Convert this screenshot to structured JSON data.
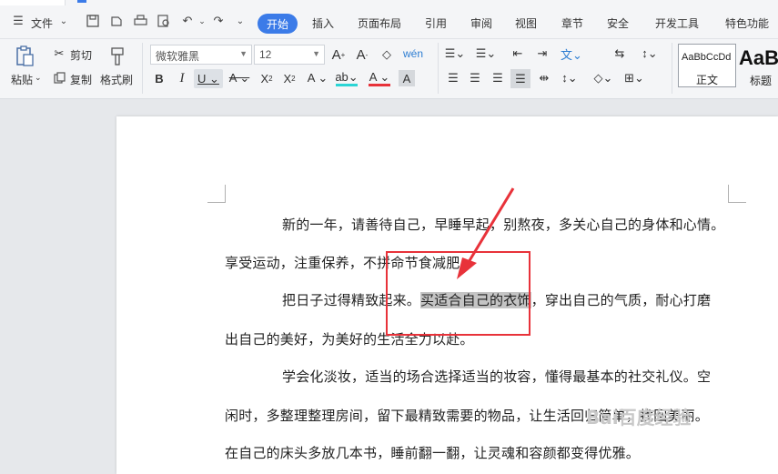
{
  "menubar": {
    "file_label": "文件",
    "tabs": [
      "开始",
      "插入",
      "页面布局",
      "引用",
      "审阅",
      "视图",
      "章节",
      "安全",
      "开发工具",
      "特色功能"
    ]
  },
  "ribbon": {
    "paste_label": "粘贴",
    "cut_label": "剪切",
    "copy_label": "复制",
    "format_painter_label": "格式刷",
    "font_name": "微软雅黑",
    "font_size": "12",
    "styles": [
      {
        "preview": "AaBbCcDd",
        "label": "正文"
      },
      {
        "preview": "AaB",
        "label": "标题"
      }
    ]
  },
  "document": {
    "lines": [
      "新的一年，请善待自己，早睡早起，别熬夜，多关心自己的身体和心情。",
      "享受运动，注重保养，不拼命节食减肥。",
      "把日子过得精致起来。",
      "买适合自己的衣饰",
      "，穿出自己的气质，耐心打磨",
      "出自己的美好，为美好的生活全力以赴。",
      "学会化淡妆，适当的场合选择适当的妆容，懂得最基本的社交礼仪。空",
      "闲时，多整理整理房间，留下最精致需要的物品，让生活回归简单，找回美丽。",
      "在自己的床头多放几本书，睡前翻一翻，让灵魂和容颜都变得优雅。"
    ]
  },
  "watermark": "Bai百度经验",
  "colors": {
    "accent": "#3b7be8",
    "annotation": "#e8323a",
    "highlight": "#c4c4c4"
  }
}
